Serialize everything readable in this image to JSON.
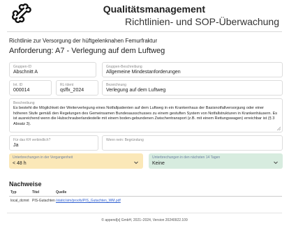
{
  "header": {
    "title": "Qualitätsmanagement",
    "subtitle": "Richtlinien- und SOP-Überwachung",
    "logo_icon": "bone-icon"
  },
  "guideline": {
    "subheading": "Richtlinie zur Versorgung der hüftgelenknahen Femurfraktur",
    "title": "Anforderung: A7 - Verlegung auf dem Luftweg"
  },
  "fields": {
    "group_id": {
      "label": "Gruppen-ID",
      "value": "Abschnitt A"
    },
    "group_desc": {
      "label": "Gruppen-Beschreibung",
      "value": "Allgemeine Mindestanforderungen"
    },
    "int_id": {
      "label": "Int. ID",
      "value": "000014"
    },
    "rl_ident": {
      "label": "RL-Ident",
      "value": "qsffx_2024"
    },
    "designation": {
      "label": "Bezeichnung",
      "value": "Verlegung auf dem Luftweg"
    },
    "description": {
      "label": "Beschreibung",
      "value": "Es besteht die Möglichkeit der Weiterverlegung eines Notfallpatienten auf dem Luftweg in ein Krankenhaus der Basisnotfallversorgung oder einer höheren Stufe gemäß den Regelungen des Gemeinsamen Bundesausschusses zu einem gestuften System von Notfallstrukturen in Krankenhäusern. Es ist ausreichend wenn die Hubschrauberlandestelle mit einem boden-gebundenen Zwischentransport (z.B. mit einem Rettungswagen) erreichbar ist (§ 3 Absatz 3)."
    },
    "kh_binding": {
      "label": "Für das KH verbindlich?",
      "value": "Ja"
    },
    "reason": {
      "label": "Wenn nein: Begründung",
      "value": ""
    }
  },
  "alerts": {
    "past": {
      "label": "Unterbrechungen in der Vergangenheit",
      "value": "< 48 h",
      "color": "#fbe8b8"
    },
    "next": {
      "label": "Unterbrechungen in den nächsten 14 Tagen",
      "value": "Keine",
      "color": "#d7ecdf"
    }
  },
  "evidence": {
    "title": "Nachweise",
    "columns": [
      "Typ",
      "Titel",
      "Quelle"
    ],
    "rows": [
      {
        "typ": "local_dcmnt",
        "titel": "PIS-Gutachten",
        "quelle": "/static/sim/proofs/PIS_Gutachten_WM.pdf"
      }
    ]
  },
  "footer": "© append[x] GmbH, 2021–2024, Version 20240922.109"
}
